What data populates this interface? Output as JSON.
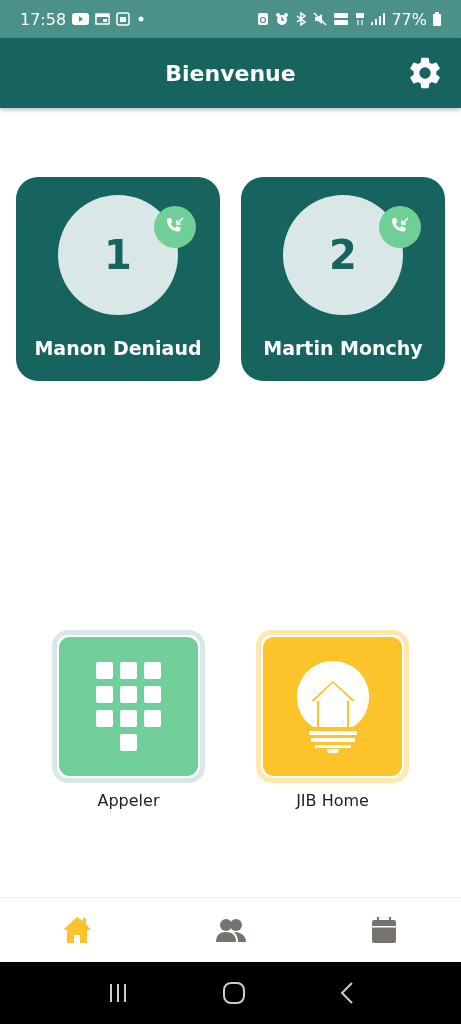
{
  "status_bar": {
    "time": "17:58",
    "battery": "77%"
  },
  "header": {
    "title": "Bienvenue"
  },
  "contacts": [
    {
      "number": "1",
      "name": "Manon Deniaud"
    },
    {
      "number": "2",
      "name": "Martin Monchy"
    }
  ],
  "apps": [
    {
      "label": "Appeler",
      "kind": "dialpad"
    },
    {
      "label": "JIB Home",
      "kind": "smart-home"
    }
  ],
  "bottom_nav": [
    {
      "kind": "home",
      "selected": true
    },
    {
      "kind": "contacts",
      "selected": false
    },
    {
      "kind": "calendar",
      "selected": false
    }
  ]
}
